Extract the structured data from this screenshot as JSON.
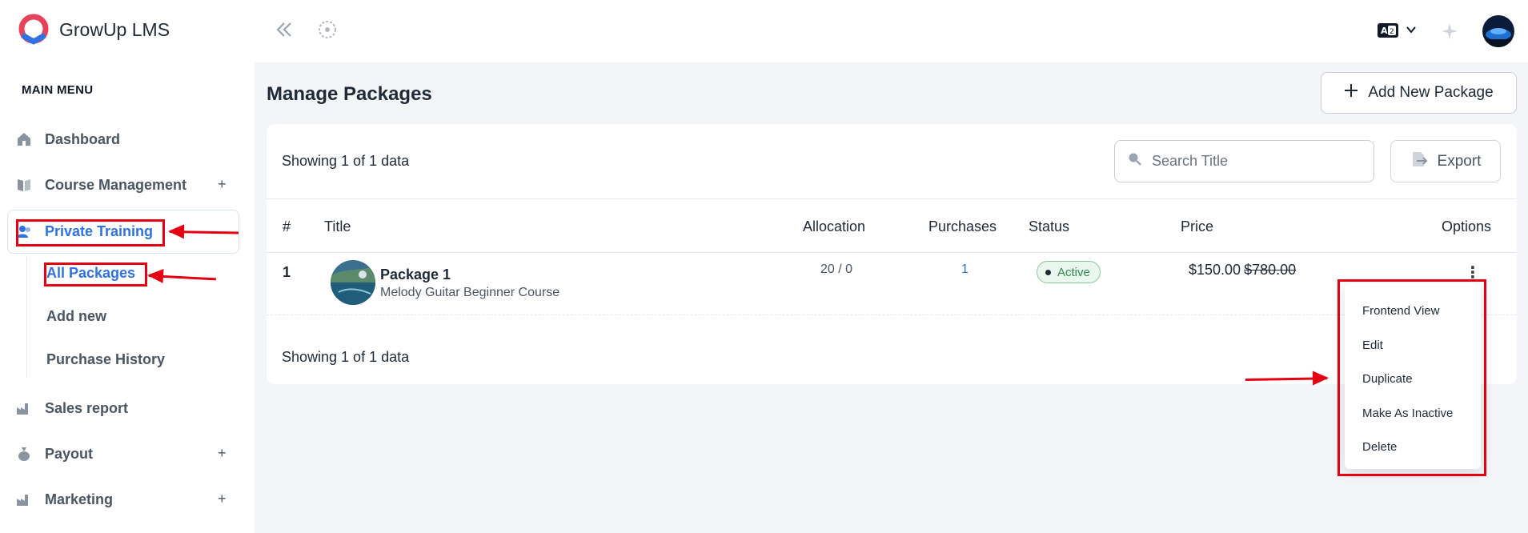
{
  "brand": {
    "name": "GrowUp LMS"
  },
  "sidebar": {
    "section_label": "MAIN MENU",
    "items": [
      {
        "label": "Dashboard",
        "icon": "home-icon"
      },
      {
        "label": "Course Management",
        "icon": "book-icon",
        "expand": "+"
      },
      {
        "label": "Private Training",
        "icon": "user-group-icon"
      },
      {
        "label": "Sales report",
        "icon": "factory-icon"
      },
      {
        "label": "Payout",
        "icon": "money-bag-icon",
        "expand": "+"
      },
      {
        "label": "Marketing",
        "icon": "factory-icon",
        "expand": "+"
      }
    ],
    "sub_items": [
      {
        "label": "All Packages"
      },
      {
        "label": "Add new"
      },
      {
        "label": "Purchase History"
      }
    ]
  },
  "header": {
    "language_icon": "translate-icon",
    "collapse_icon": "double-chevron-left-icon",
    "globe_icon": "globe-icon"
  },
  "main": {
    "title": "Manage Packages",
    "add_button": "Add New Package",
    "showing_top": "Showing 1 of 1 data",
    "showing_bottom": "Showing 1 of 1 data",
    "search_placeholder": "Search Title",
    "export_label": "Export",
    "columns": [
      "#",
      "Title",
      "Allocation",
      "Purchases",
      "Status",
      "Price",
      "Options"
    ],
    "rows": [
      {
        "index": "1",
        "title": "Package 1",
        "subtitle": "Melody Guitar Beginner Course",
        "allocation": "20 / 0",
        "purchases": "1",
        "status": "Active",
        "price": "$150.00",
        "old_price": "$780.00",
        "options_icon": "⋮"
      }
    ]
  },
  "dropdown": {
    "items": [
      "Frontend View",
      "Edit",
      "Duplicate",
      "Make As Inactive",
      "Delete"
    ]
  },
  "colors": {
    "accent": "#2e72e6",
    "annotation_red": "#e60012",
    "status_green": "#2f8a4b"
  }
}
